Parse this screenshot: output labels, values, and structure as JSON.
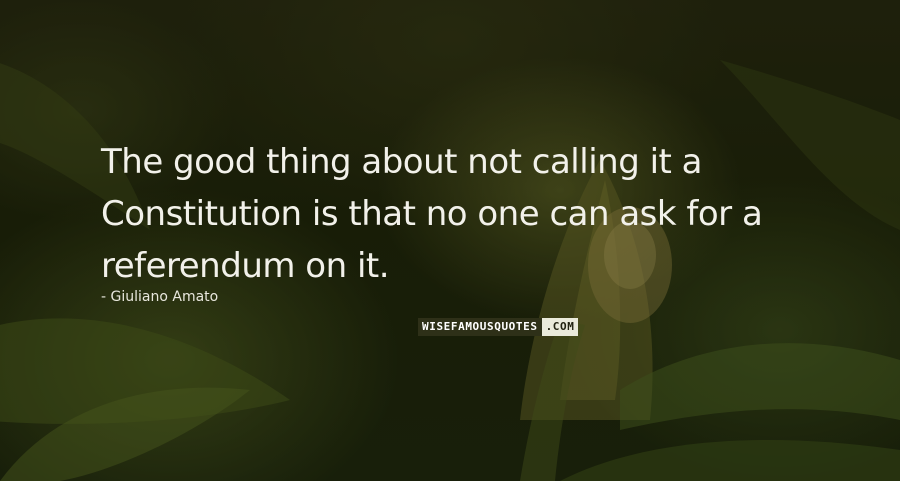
{
  "quote": {
    "line1": "The good thing about not calling it a",
    "line2": "Constitution is that no one can ask for a",
    "line3": "referendum on it."
  },
  "author": {
    "text": "Giuliano Amato"
  },
  "watermark": {
    "main": "WISEFAMOUSQUOTES",
    "suffix": ".COM"
  },
  "background": {
    "subject": "blurred green corn plant with husk and silk at night",
    "colors": [
      "#1d2209",
      "#5c6a24",
      "#7a6e2c"
    ]
  }
}
